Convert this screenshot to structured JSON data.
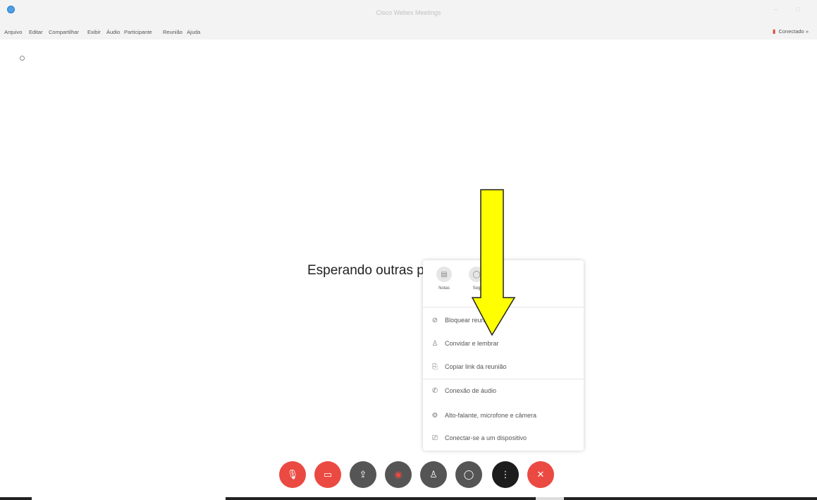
{
  "window": {
    "title": "Cisco Webex Meetings",
    "controls": "– □"
  },
  "menubar": {
    "items": [
      "Arquivo",
      "Editar",
      "Compartilhar",
      "Exibir",
      "Áudio",
      "Participante",
      "Reunião",
      "Ajuda"
    ],
    "connection_status": "Conectado"
  },
  "main": {
    "waiting_text": "Esperando outras p"
  },
  "popup": {
    "quick_buttons": [
      {
        "label": "Notas",
        "icon": "notes-icon"
      },
      {
        "label": "Seg",
        "icon": "generic-icon"
      }
    ],
    "items": [
      {
        "label": "Bloquear reunião",
        "icon": "lock-icon"
      },
      {
        "label": "Convidar e lembrar",
        "icon": "person-icon"
      },
      {
        "label": "Copiar link da reunião",
        "icon": "copy-icon"
      },
      {
        "label": "Conexão de áudio",
        "icon": "phone-icon"
      },
      {
        "label": "Alto-falante, microfone e câmera",
        "icon": "gear-icon"
      },
      {
        "label": "Conectar-se a um dispositivo",
        "icon": "cast-icon"
      }
    ]
  },
  "controls": {
    "mute": "mic-muted-icon",
    "video": "video-off-icon",
    "share": "share-icon",
    "record": "record-icon",
    "participants": "participants-icon",
    "chat": "chat-icon",
    "more": "more-icon",
    "leave": "close-icon"
  },
  "colors": {
    "red": "#ea4a42",
    "gray": "#555555",
    "black": "#1c1c1c",
    "arrow": "#ffff00"
  }
}
